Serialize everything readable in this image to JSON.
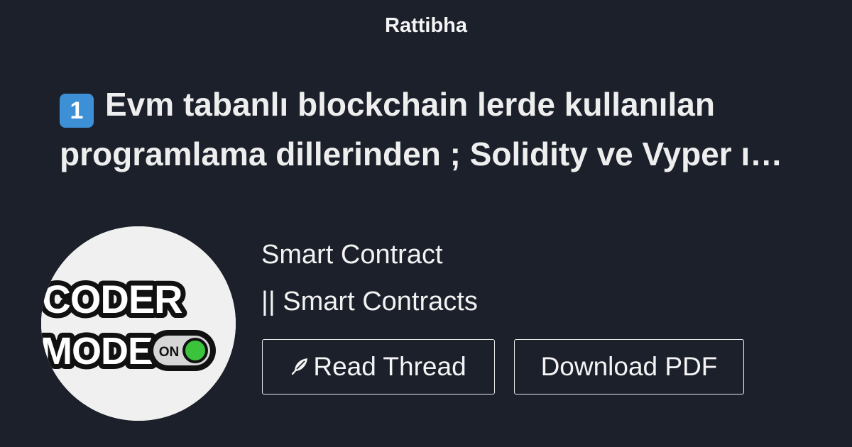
{
  "brand": {
    "name": "Rattibha"
  },
  "thread": {
    "keycap": "1",
    "title_line1": "Evm tabanlı blockchain lerde kullanılan",
    "title_line2": "programlama dillerinden ; Solidity ve Vyper ı…"
  },
  "author": {
    "avatar_line1": "CODER",
    "avatar_line2": "MODE",
    "avatar_toggle": "ON",
    "name": "Smart Contract",
    "handle": "|| Smart Contracts"
  },
  "actions": {
    "read_label": "Read Thread",
    "pdf_label": "Download PDF"
  },
  "colors": {
    "background": "#1b202b",
    "keycap": "#3d8fd6",
    "toggle_green": "#3cc33c"
  },
  "icons": {
    "read": "feather-icon"
  }
}
